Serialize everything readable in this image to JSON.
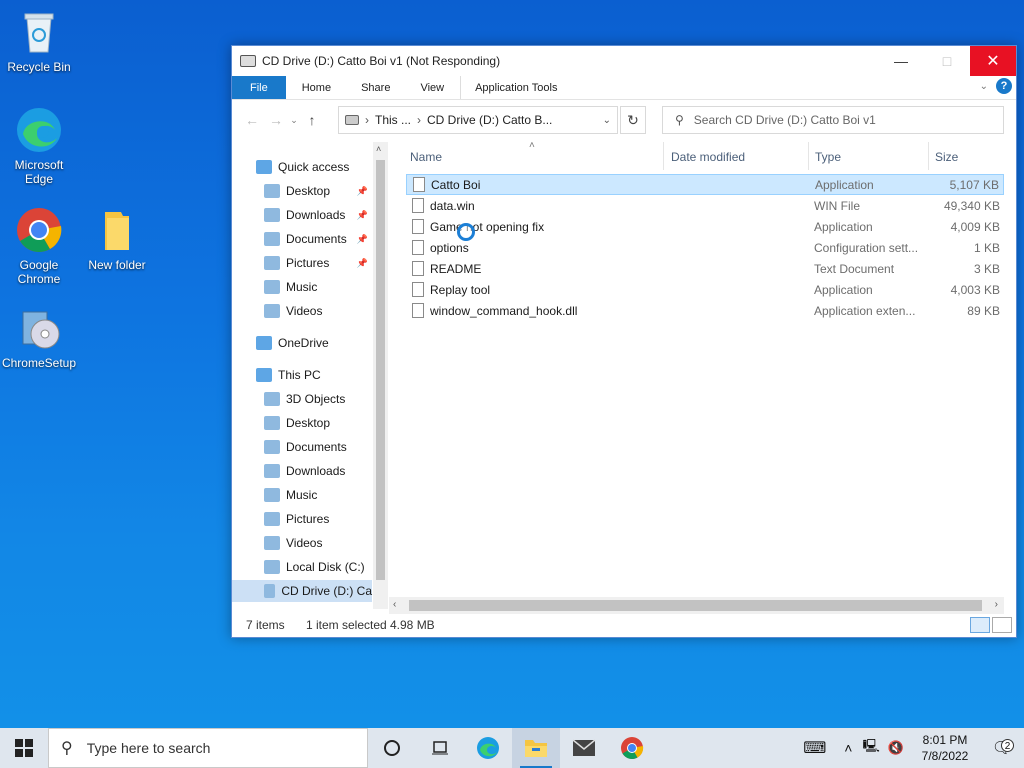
{
  "desktop": {
    "icons": [
      {
        "label": "Recycle Bin",
        "icon": "recycle-bin-icon"
      },
      {
        "label": "Microsoft Edge",
        "icon": "edge-icon"
      },
      {
        "label": "Google Chrome",
        "icon": "chrome-icon"
      },
      {
        "label": "New folder",
        "icon": "folder-icon"
      },
      {
        "label": "ChromeSetup",
        "icon": "setup-icon"
      }
    ]
  },
  "window": {
    "title": "CD Drive (D:) Catto Boi v1 (Not Responding)",
    "ribbon_tabs": [
      "File",
      "Home",
      "Share",
      "View",
      "Application Tools"
    ],
    "address": {
      "seg1": "This ...",
      "seg2": "CD Drive (D:) Catto B..."
    },
    "search_placeholder": "Search CD Drive (D:) Catto Boi v1",
    "columns": {
      "name": "Name",
      "date": "Date modified",
      "type": "Type",
      "size": "Size"
    },
    "files": [
      {
        "name": "Catto Boi",
        "type": "Application",
        "size": "5,107 KB",
        "selected": true
      },
      {
        "name": "data.win",
        "type": "WIN File",
        "size": "49,340 KB"
      },
      {
        "name": "Game not opening fix",
        "type": "Application",
        "size": "4,009 KB"
      },
      {
        "name": "options",
        "type": "Configuration sett...",
        "size": "1 KB"
      },
      {
        "name": "README",
        "type": "Text Document",
        "size": "3 KB"
      },
      {
        "name": "Replay tool",
        "type": "Application",
        "size": "4,003 KB"
      },
      {
        "name": "window_command_hook.dll",
        "type": "Application exten...",
        "size": "89 KB"
      }
    ],
    "nav": [
      {
        "label": "Quick access",
        "level": 0
      },
      {
        "label": "Desktop",
        "level": 1,
        "pinned": true
      },
      {
        "label": "Downloads",
        "level": 1,
        "pinned": true
      },
      {
        "label": "Documents",
        "level": 1,
        "pinned": true
      },
      {
        "label": "Pictures",
        "level": 1,
        "pinned": true
      },
      {
        "label": "Music",
        "level": 1
      },
      {
        "label": "Videos",
        "level": 1
      },
      {
        "label": "OneDrive",
        "level": 0
      },
      {
        "label": "This PC",
        "level": 0
      },
      {
        "label": "3D Objects",
        "level": 1
      },
      {
        "label": "Desktop",
        "level": 1
      },
      {
        "label": "Documents",
        "level": 1
      },
      {
        "label": "Downloads",
        "level": 1
      },
      {
        "label": "Music",
        "level": 1
      },
      {
        "label": "Pictures",
        "level": 1
      },
      {
        "label": "Videos",
        "level": 1
      },
      {
        "label": "Local Disk (C:)",
        "level": 1
      },
      {
        "label": "CD Drive (D:) Ca",
        "level": 1,
        "selected": true
      }
    ],
    "status": {
      "items": "7 items",
      "selected": "1 item selected",
      "size": "4.98 MB"
    }
  },
  "taskbar": {
    "search_placeholder": "Type here to search",
    "time": "8:01 PM",
    "date": "7/8/2022",
    "notifications": "2"
  }
}
